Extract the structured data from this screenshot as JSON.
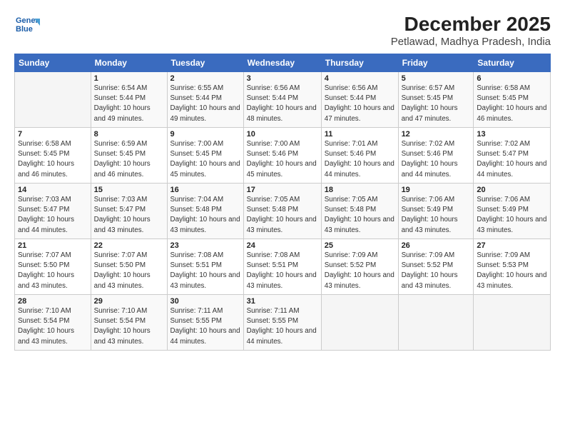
{
  "logo": {
    "line1": "General",
    "line2": "Blue"
  },
  "header": {
    "month_year": "December 2025",
    "location": "Petlawad, Madhya Pradesh, India"
  },
  "weekdays": [
    "Sunday",
    "Monday",
    "Tuesday",
    "Wednesday",
    "Thursday",
    "Friday",
    "Saturday"
  ],
  "weeks": [
    [
      {
        "day": "",
        "sunrise": "",
        "sunset": "",
        "daylight": ""
      },
      {
        "day": "1",
        "sunrise": "Sunrise: 6:54 AM",
        "sunset": "Sunset: 5:44 PM",
        "daylight": "Daylight: 10 hours and 49 minutes."
      },
      {
        "day": "2",
        "sunrise": "Sunrise: 6:55 AM",
        "sunset": "Sunset: 5:44 PM",
        "daylight": "Daylight: 10 hours and 49 minutes."
      },
      {
        "day": "3",
        "sunrise": "Sunrise: 6:56 AM",
        "sunset": "Sunset: 5:44 PM",
        "daylight": "Daylight: 10 hours and 48 minutes."
      },
      {
        "day": "4",
        "sunrise": "Sunrise: 6:56 AM",
        "sunset": "Sunset: 5:44 PM",
        "daylight": "Daylight: 10 hours and 47 minutes."
      },
      {
        "day": "5",
        "sunrise": "Sunrise: 6:57 AM",
        "sunset": "Sunset: 5:45 PM",
        "daylight": "Daylight: 10 hours and 47 minutes."
      },
      {
        "day": "6",
        "sunrise": "Sunrise: 6:58 AM",
        "sunset": "Sunset: 5:45 PM",
        "daylight": "Daylight: 10 hours and 46 minutes."
      }
    ],
    [
      {
        "day": "7",
        "sunrise": "Sunrise: 6:58 AM",
        "sunset": "Sunset: 5:45 PM",
        "daylight": "Daylight: 10 hours and 46 minutes."
      },
      {
        "day": "8",
        "sunrise": "Sunrise: 6:59 AM",
        "sunset": "Sunset: 5:45 PM",
        "daylight": "Daylight: 10 hours and 46 minutes."
      },
      {
        "day": "9",
        "sunrise": "Sunrise: 7:00 AM",
        "sunset": "Sunset: 5:45 PM",
        "daylight": "Daylight: 10 hours and 45 minutes."
      },
      {
        "day": "10",
        "sunrise": "Sunrise: 7:00 AM",
        "sunset": "Sunset: 5:46 PM",
        "daylight": "Daylight: 10 hours and 45 minutes."
      },
      {
        "day": "11",
        "sunrise": "Sunrise: 7:01 AM",
        "sunset": "Sunset: 5:46 PM",
        "daylight": "Daylight: 10 hours and 44 minutes."
      },
      {
        "day": "12",
        "sunrise": "Sunrise: 7:02 AM",
        "sunset": "Sunset: 5:46 PM",
        "daylight": "Daylight: 10 hours and 44 minutes."
      },
      {
        "day": "13",
        "sunrise": "Sunrise: 7:02 AM",
        "sunset": "Sunset: 5:47 PM",
        "daylight": "Daylight: 10 hours and 44 minutes."
      }
    ],
    [
      {
        "day": "14",
        "sunrise": "Sunrise: 7:03 AM",
        "sunset": "Sunset: 5:47 PM",
        "daylight": "Daylight: 10 hours and 44 minutes."
      },
      {
        "day": "15",
        "sunrise": "Sunrise: 7:03 AM",
        "sunset": "Sunset: 5:47 PM",
        "daylight": "Daylight: 10 hours and 43 minutes."
      },
      {
        "day": "16",
        "sunrise": "Sunrise: 7:04 AM",
        "sunset": "Sunset: 5:48 PM",
        "daylight": "Daylight: 10 hours and 43 minutes."
      },
      {
        "day": "17",
        "sunrise": "Sunrise: 7:05 AM",
        "sunset": "Sunset: 5:48 PM",
        "daylight": "Daylight: 10 hours and 43 minutes."
      },
      {
        "day": "18",
        "sunrise": "Sunrise: 7:05 AM",
        "sunset": "Sunset: 5:48 PM",
        "daylight": "Daylight: 10 hours and 43 minutes."
      },
      {
        "day": "19",
        "sunrise": "Sunrise: 7:06 AM",
        "sunset": "Sunset: 5:49 PM",
        "daylight": "Daylight: 10 hours and 43 minutes."
      },
      {
        "day": "20",
        "sunrise": "Sunrise: 7:06 AM",
        "sunset": "Sunset: 5:49 PM",
        "daylight": "Daylight: 10 hours and 43 minutes."
      }
    ],
    [
      {
        "day": "21",
        "sunrise": "Sunrise: 7:07 AM",
        "sunset": "Sunset: 5:50 PM",
        "daylight": "Daylight: 10 hours and 43 minutes."
      },
      {
        "day": "22",
        "sunrise": "Sunrise: 7:07 AM",
        "sunset": "Sunset: 5:50 PM",
        "daylight": "Daylight: 10 hours and 43 minutes."
      },
      {
        "day": "23",
        "sunrise": "Sunrise: 7:08 AM",
        "sunset": "Sunset: 5:51 PM",
        "daylight": "Daylight: 10 hours and 43 minutes."
      },
      {
        "day": "24",
        "sunrise": "Sunrise: 7:08 AM",
        "sunset": "Sunset: 5:51 PM",
        "daylight": "Daylight: 10 hours and 43 minutes."
      },
      {
        "day": "25",
        "sunrise": "Sunrise: 7:09 AM",
        "sunset": "Sunset: 5:52 PM",
        "daylight": "Daylight: 10 hours and 43 minutes."
      },
      {
        "day": "26",
        "sunrise": "Sunrise: 7:09 AM",
        "sunset": "Sunset: 5:52 PM",
        "daylight": "Daylight: 10 hours and 43 minutes."
      },
      {
        "day": "27",
        "sunrise": "Sunrise: 7:09 AM",
        "sunset": "Sunset: 5:53 PM",
        "daylight": "Daylight: 10 hours and 43 minutes."
      }
    ],
    [
      {
        "day": "28",
        "sunrise": "Sunrise: 7:10 AM",
        "sunset": "Sunset: 5:54 PM",
        "daylight": "Daylight: 10 hours and 43 minutes."
      },
      {
        "day": "29",
        "sunrise": "Sunrise: 7:10 AM",
        "sunset": "Sunset: 5:54 PM",
        "daylight": "Daylight: 10 hours and 43 minutes."
      },
      {
        "day": "30",
        "sunrise": "Sunrise: 7:11 AM",
        "sunset": "Sunset: 5:55 PM",
        "daylight": "Daylight: 10 hours and 44 minutes."
      },
      {
        "day": "31",
        "sunrise": "Sunrise: 7:11 AM",
        "sunset": "Sunset: 5:55 PM",
        "daylight": "Daylight: 10 hours and 44 minutes."
      },
      {
        "day": "",
        "sunrise": "",
        "sunset": "",
        "daylight": ""
      },
      {
        "day": "",
        "sunrise": "",
        "sunset": "",
        "daylight": ""
      },
      {
        "day": "",
        "sunrise": "",
        "sunset": "",
        "daylight": ""
      }
    ]
  ]
}
